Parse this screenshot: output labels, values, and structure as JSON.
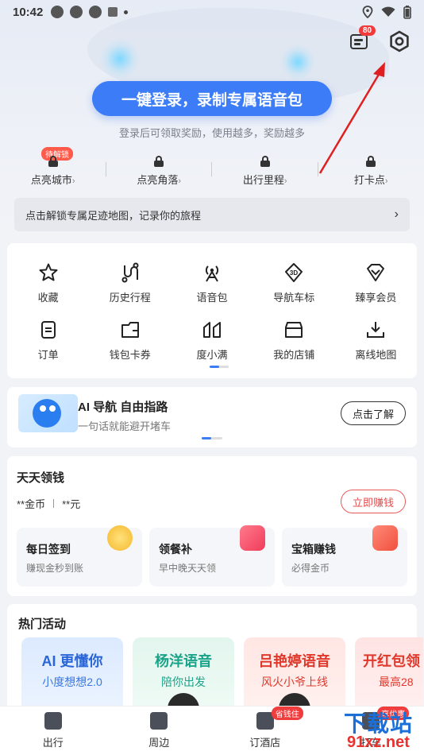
{
  "status_bar": {
    "time": "10:42"
  },
  "header": {
    "message_badge": "80",
    "login_button": "一键登录，录制专属语音包",
    "login_subtitle": "登录后可领取奖励，使用越多，奖励越多",
    "unlock_tag": "待解锁",
    "stats": [
      {
        "label": "点亮城市"
      },
      {
        "label": "点亮角落"
      },
      {
        "label": "出行里程"
      },
      {
        "label": "打卡点"
      }
    ],
    "unlock_bar": "点击解锁专属足迹地图，记录你的旅程"
  },
  "grid": {
    "row1": [
      {
        "label": "收藏",
        "icon": "star-icon"
      },
      {
        "label": "历史行程",
        "icon": "route-icon"
      },
      {
        "label": "语音包",
        "icon": "voice-pack-icon"
      },
      {
        "label": "导航车标",
        "icon": "car-3d-icon"
      },
      {
        "label": "臻享会员",
        "icon": "diamond-icon"
      }
    ],
    "row2": [
      {
        "label": "订单",
        "icon": "order-icon"
      },
      {
        "label": "钱包卡券",
        "icon": "wallet-icon"
      },
      {
        "label": "度小满",
        "icon": "duxiaoman-icon"
      },
      {
        "label": "我的店铺",
        "icon": "store-icon"
      },
      {
        "label": "离线地图",
        "icon": "download-icon"
      }
    ]
  },
  "ai_card": {
    "title": "AI 导航 自由指路",
    "subtitle": "一句话就能避开堵车",
    "button": "点击了解"
  },
  "earn": {
    "title": "天天领钱",
    "coins": "**金币",
    "cash": "**元",
    "button": "立即赚钱",
    "tasks": [
      {
        "title": "每日签到",
        "subtitle": "赚现金秒到账"
      },
      {
        "title": "领餐补",
        "subtitle": "早中晚天天领"
      },
      {
        "title": "宝箱赚钱",
        "subtitle": "必得金币"
      }
    ]
  },
  "hot": {
    "title": "热门活动",
    "items": [
      {
        "title": "AI 更懂你",
        "subtitle": "小度想想2.0"
      },
      {
        "title": "杨洋语音",
        "subtitle": "陪你出发"
      },
      {
        "title": "吕艳婷语音",
        "subtitle": "风火小爷上线"
      },
      {
        "title": "开红包领",
        "subtitle": "最高28"
      }
    ]
  },
  "tabbar": {
    "tabs": [
      {
        "label": "出行"
      },
      {
        "label": "周边"
      },
      {
        "label": "订酒店",
        "badge": "省钱住"
      },
      {
        "label": "打车",
        "badge": "享优惠"
      }
    ]
  },
  "watermark": {
    "big": "下载站",
    "small": "91xz.net"
  },
  "colors": {
    "primary": "#3c7cf7",
    "accent_red": "#e84a4a",
    "arrow": "#e02020"
  }
}
